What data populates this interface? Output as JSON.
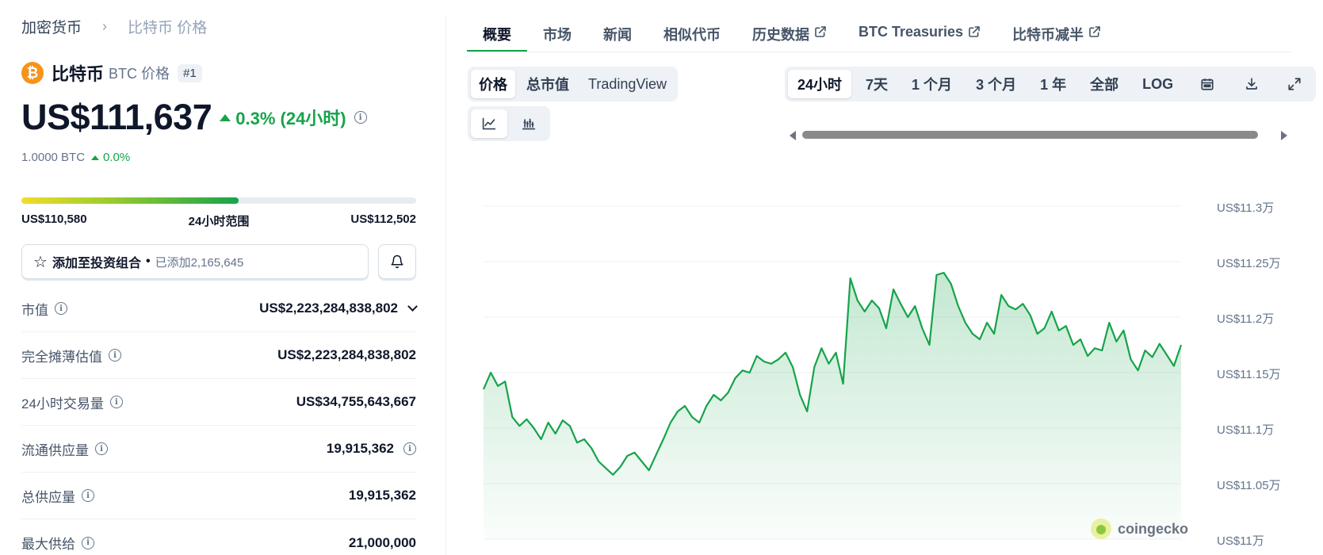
{
  "breadcrumb": {
    "root": "加密货币",
    "current": "比特币 价格"
  },
  "coin": {
    "logo_glyph": "₿",
    "name": "比特币",
    "symbol_label": "BTC 价格",
    "rank": "#1",
    "brand_color": "#f7931a"
  },
  "price": {
    "value": "US$111,637",
    "change": "0.3% (24小时)",
    "btc_value": "1.0000 BTC",
    "btc_change": "0.0%"
  },
  "range": {
    "low": "US$110,580",
    "label": "24小时范围",
    "high": "US$112,502",
    "position_fraction": 0.55
  },
  "portfolio": {
    "label": "添加至投资组合",
    "separator": "•",
    "count": "已添加2,165,645"
  },
  "stats": [
    {
      "label": "市值",
      "value": "US$2,223,284,838,802"
    },
    {
      "label": "完全摊薄估值",
      "value": "US$2,223,284,838,802"
    },
    {
      "label": "24小时交易量",
      "value": "US$34,755,643,667"
    },
    {
      "label": "流通供应量",
      "value": "19,915,362"
    },
    {
      "label": "总供应量",
      "value": "19,915,362"
    },
    {
      "label": "最大供给",
      "value": "21,000,000"
    }
  ],
  "tabs": [
    "概要",
    "市场",
    "新闻",
    "相似代币",
    "历史数据",
    "BTC Treasuries",
    "比特币减半"
  ],
  "chart_types": [
    "价格",
    "总市值",
    "TradingView"
  ],
  "time_ranges": [
    "24小时",
    "7天",
    "1 个月",
    "3 个月",
    "1 年",
    "全部",
    "LOG"
  ],
  "colors": {
    "positive": "#16a34a",
    "line": "#16a34a"
  },
  "chart_data": {
    "type": "area",
    "y_tick_labels": [
      "US$11.3万",
      "US$11.25万",
      "US$11.2万",
      "US$11.15万",
      "US$11.1万",
      "US$11.05万",
      "US$11万"
    ],
    "y_ticks": [
      113000,
      112500,
      112000,
      111500,
      111000,
      110500,
      110000
    ],
    "ylim": [
      110000,
      113000
    ],
    "grid": true,
    "watermark": "coingecko",
    "values": [
      111350,
      111500,
      111380,
      111420,
      111100,
      111020,
      111080,
      111000,
      110900,
      111050,
      110950,
      111070,
      111020,
      110870,
      110900,
      110820,
      110700,
      110640,
      110580,
      110650,
      110750,
      110780,
      110700,
      110620,
      110760,
      110900,
      111050,
      111150,
      111200,
      111100,
      111050,
      111200,
      111300,
      111250,
      111320,
      111450,
      111520,
      111500,
      111650,
      111600,
      111580,
      111620,
      111680,
      111550,
      111300,
      111150,
      111550,
      111720,
      111580,
      111680,
      111400,
      112350,
      112150,
      112050,
      112150,
      112080,
      111900,
      112250,
      112120,
      112000,
      112100,
      111900,
      111750,
      112380,
      112400,
      112300,
      112100,
      111950,
      111850,
      111800,
      111950,
      111850,
      112200,
      112100,
      112070,
      112120,
      112020,
      111850,
      111900,
      112050,
      111880,
      111920,
      111750,
      111800,
      111650,
      111720,
      111700,
      111950,
      111780,
      111880,
      111620,
      111520,
      111700,
      111640,
      111760,
      111660,
      111560,
      111750
    ]
  }
}
